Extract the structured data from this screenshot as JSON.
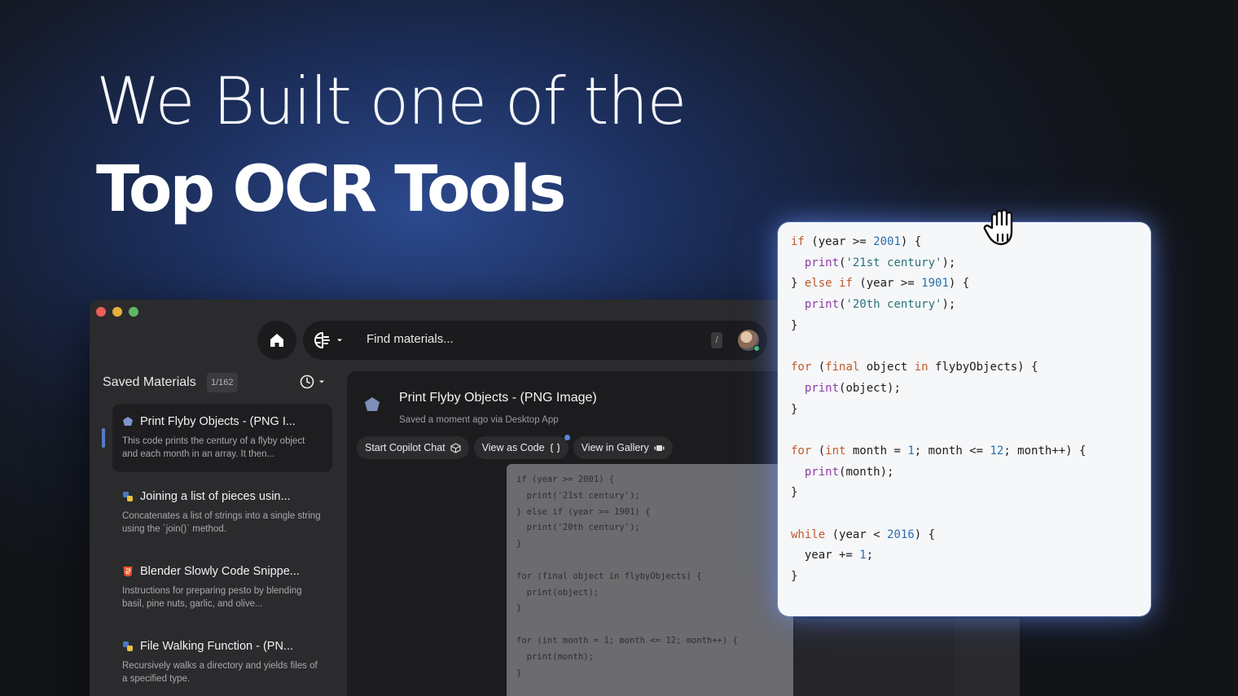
{
  "hero": {
    "line1": "We Built one of the",
    "line2": "Top OCR Tools"
  },
  "search": {
    "placeholder": "Find materials...",
    "shortcut": "/"
  },
  "sidebar": {
    "title": "Saved Materials",
    "count": "1/162",
    "items": [
      {
        "title": "Print Flyby Objects - (PNG I...",
        "desc": "This code prints the century of a flyby object and each month in an array. It then...",
        "icon": "image-icon"
      },
      {
        "title": "Joining a list of pieces usin...",
        "desc": "Concatenates a list of strings into a single string using the `join()` method.",
        "icon": "python-icon"
      },
      {
        "title": "Blender Slowly Code Snippe...",
        "desc": "Instructions for preparing pesto by blending basil, pine nuts, garlic, and olive...",
        "icon": "html5-icon"
      },
      {
        "title": "File Walking Function - (PN...",
        "desc": "Recursively walks a directory and yields files of a specified type.",
        "icon": "python-icon"
      }
    ]
  },
  "detail": {
    "title": "Print Flyby Objects - (PNG Image)",
    "meta": "Saved a moment ago via Desktop App",
    "actions": [
      "Start Copilot Chat",
      "View as Code",
      "View in Gallery"
    ]
  },
  "code_preview": "if (year >= 2001) {\n  print('21st century');\n} else if (year >= 1901) {\n  print('20th century');\n}\n\nfor (final object in flybyObjects) {\n  print(object);\n}\n\nfor (int month = 1; month <= 12; month++) {\n  print(month);\n}",
  "code_card": [
    [
      [
        "kw",
        "if"
      ],
      [
        "t",
        " (year >= "
      ],
      [
        "num",
        "2001"
      ],
      [
        "t",
        ") {"
      ]
    ],
    [
      [
        "t",
        "  "
      ],
      [
        "fn",
        "print"
      ],
      [
        "t",
        "("
      ],
      [
        "str",
        "'21st century'"
      ],
      [
        "t",
        ");"
      ]
    ],
    [
      [
        "t",
        "} "
      ],
      [
        "kw",
        "else if"
      ],
      [
        "t",
        " (year >= "
      ],
      [
        "num",
        "1901"
      ],
      [
        "t",
        ") {"
      ]
    ],
    [
      [
        "t",
        "  "
      ],
      [
        "fn",
        "print"
      ],
      [
        "t",
        "("
      ],
      [
        "str",
        "'20th century'"
      ],
      [
        "t",
        ");"
      ]
    ],
    [
      [
        "t",
        "}"
      ]
    ],
    [
      [
        "t",
        ""
      ]
    ],
    [
      [
        "kw",
        "for"
      ],
      [
        "t",
        " ("
      ],
      [
        "kw",
        "final"
      ],
      [
        "t",
        " object "
      ],
      [
        "kw",
        "in"
      ],
      [
        "t",
        " flybyObjects) {"
      ]
    ],
    [
      [
        "t",
        "  "
      ],
      [
        "fn",
        "print"
      ],
      [
        "t",
        "(object);"
      ]
    ],
    [
      [
        "t",
        "}"
      ]
    ],
    [
      [
        "t",
        ""
      ]
    ],
    [
      [
        "kw",
        "for"
      ],
      [
        "t",
        " ("
      ],
      [
        "kw",
        "int"
      ],
      [
        "t",
        " month = "
      ],
      [
        "num",
        "1"
      ],
      [
        "t",
        "; month <= "
      ],
      [
        "num",
        "12"
      ],
      [
        "t",
        "; month++) {"
      ]
    ],
    [
      [
        "t",
        "  "
      ],
      [
        "fn",
        "print"
      ],
      [
        "t",
        "(month);"
      ]
    ],
    [
      [
        "t",
        "}"
      ]
    ],
    [
      [
        "t",
        ""
      ]
    ],
    [
      [
        "kw",
        "while"
      ],
      [
        "t",
        " (year < "
      ],
      [
        "num",
        "2016"
      ],
      [
        "t",
        ") {"
      ]
    ],
    [
      [
        "t",
        "  year += "
      ],
      [
        "num",
        "1"
      ],
      [
        "t",
        ";"
      ]
    ],
    [
      [
        "t",
        "}"
      ]
    ]
  ],
  "colors": {
    "keyword": "#c0592b",
    "function": "#8a3ea8",
    "string": "#27717a",
    "number": "#2a6fb0",
    "accent": "#5a85e0"
  }
}
